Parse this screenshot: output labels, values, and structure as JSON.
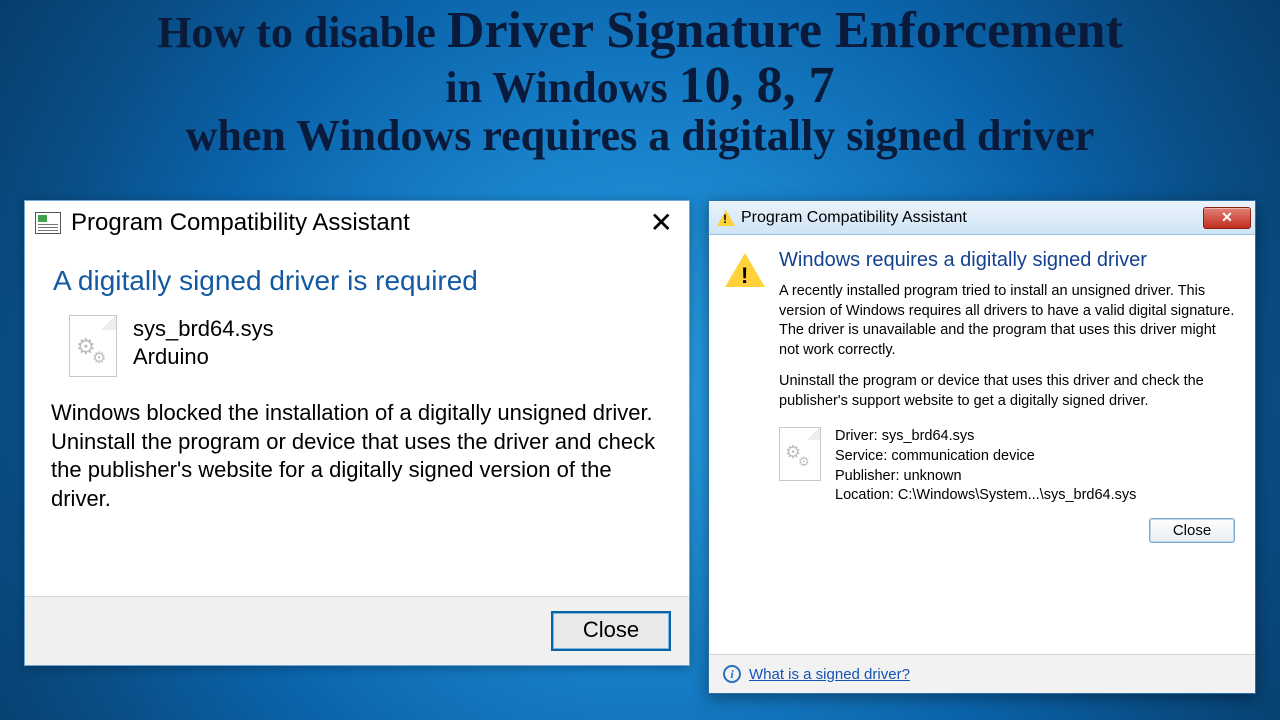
{
  "headline": {
    "line1_a": "How to disable ",
    "line1_b": "Driver Signature Enforcement",
    "line2_a": "in Windows ",
    "line2_b": "10, 8, 7",
    "line3": "when Windows requires a digitally signed driver"
  },
  "dlg10": {
    "title": "Program Compatibility Assistant",
    "heading": "A digitally signed driver is required",
    "file_name": "sys_brd64.sys",
    "file_publisher": "Arduino",
    "paragraph": "Windows blocked the installation of a digitally unsigned driver. Uninstall the program or device that uses the driver and check the publisher's website for a digitally signed version of the driver.",
    "close_label": "Close"
  },
  "dlg7": {
    "title": "Program Compatibility Assistant",
    "heading": "Windows requires a digitally signed driver",
    "para1": "A recently installed program tried to install an unsigned driver. This version of Windows requires all drivers to have a valid digital signature. The driver is unavailable and the program that uses this driver might not work correctly.",
    "para2": "Uninstall the program or device that uses this driver and check the publisher's support website to get a digitally signed driver.",
    "driver_label": "Driver: sys_brd64.sys",
    "service_label": "Service: communication device",
    "publisher_label": "Publisher: unknown",
    "location_label": "Location: C:\\Windows\\System...\\sys_brd64.sys",
    "close_label": "Close",
    "footer_link": "What is a signed driver?"
  }
}
